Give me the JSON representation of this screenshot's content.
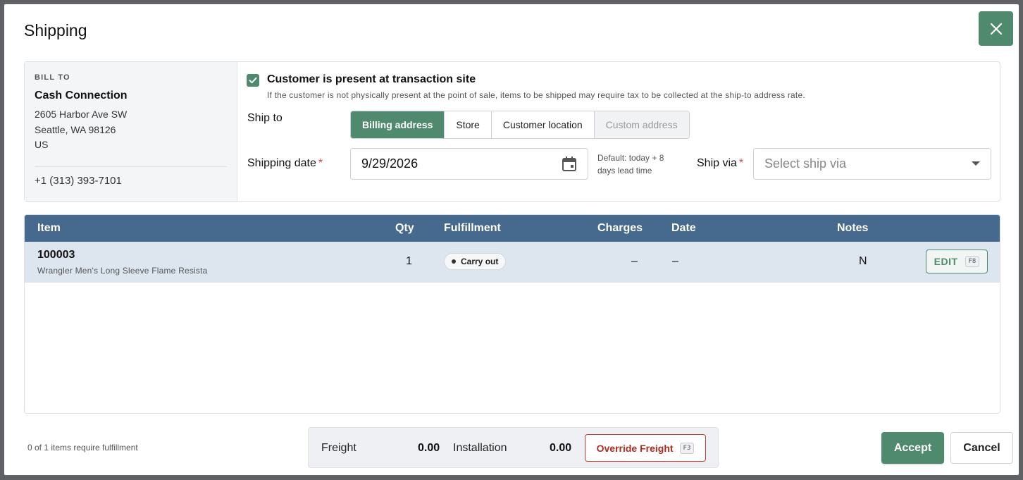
{
  "dialog": {
    "title": "Shipping"
  },
  "bill_to": {
    "label": "BILL TO",
    "name": "Cash Connection",
    "address": [
      "2605 Harbor Ave SW",
      "Seattle, WA 98126",
      "US"
    ],
    "phone": "+1 (313) 393-7101"
  },
  "customer_present": {
    "checked": true,
    "label": "Customer is present at transaction site",
    "note": "If the customer is not physically present at the point of sale, items to be shipped may require tax to be collected at the ship-to address rate."
  },
  "ship_to": {
    "label": "Ship to",
    "options": [
      {
        "label": "Billing address",
        "state": "active"
      },
      {
        "label": "Store",
        "state": "normal"
      },
      {
        "label": "Customer location",
        "state": "normal"
      },
      {
        "label": "Custom address",
        "state": "disabled"
      }
    ]
  },
  "shipping_date": {
    "label": "Shipping date",
    "required_mark": "*",
    "value": "9/29/2026",
    "default_note": "Default: today + 8 days lead time"
  },
  "ship_via": {
    "label": "Ship via",
    "required_mark": "*",
    "placeholder": "Select ship via"
  },
  "table": {
    "columns": {
      "item": "Item",
      "qty": "Qty",
      "fulfillment": "Fulfillment",
      "charges": "Charges",
      "date": "Date",
      "notes": "Notes"
    },
    "rows": [
      {
        "item": "100003",
        "description": "Wrangler Men's Long Sleeve Flame Resista",
        "qty": "1",
        "fulfillment": "Carry out",
        "charges": "–",
        "date": "–",
        "notes": "N",
        "edit_label": "EDIT",
        "edit_shortcut": "F8"
      }
    ]
  },
  "footer": {
    "fulfillment_note": "0 of 1 items require fulfillment",
    "freight_label": "Freight",
    "freight_value": "0.00",
    "installation_label": "Installation",
    "installation_value": "0.00",
    "override_label": "Override Freight",
    "override_shortcut": "F3",
    "accept_label": "Accept",
    "cancel_label": "Cancel"
  },
  "colors": {
    "primary_green": "#4f8a6e",
    "table_header": "#456a8d",
    "danger_red": "#c0392b"
  }
}
